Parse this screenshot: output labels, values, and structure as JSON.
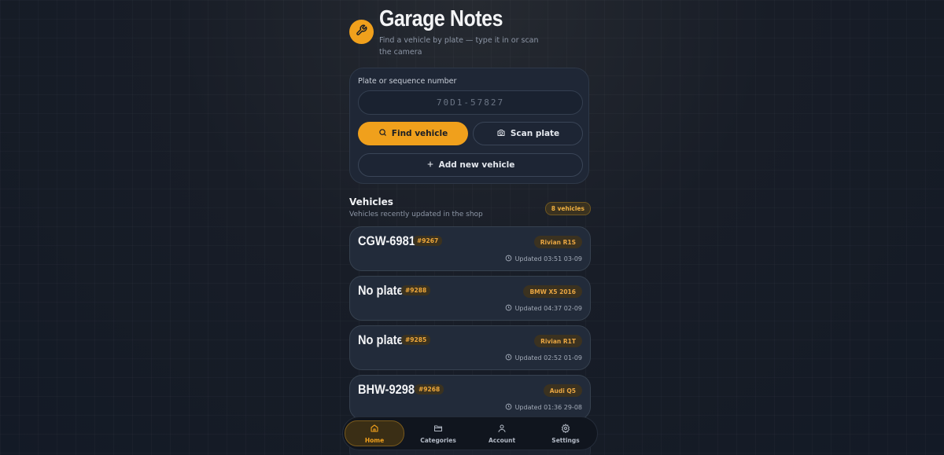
{
  "app": {
    "title": "Garage Notes",
    "subtitle": "Find a vehicle by plate — type it in or scan the camera",
    "accent_color": "#f0a01c",
    "logo_icon": "wrench-icon"
  },
  "search": {
    "label": "Plate or sequence number",
    "placeholder": "70D1-57827",
    "value": "",
    "find_label": "Find vehicle",
    "scan_label": "Scan plate",
    "add_label": "Add new vehicle"
  },
  "vehicles_section": {
    "title": "Vehicles",
    "subtitle": "Vehicles recently updated in the shop",
    "count_label": "8 vehicles"
  },
  "vehicles": [
    {
      "plate": "CGW-6981",
      "seq": "#9267",
      "model": "Rivian R1S",
      "updated": "Updated 03:51 03-09"
    },
    {
      "plate": "No plate",
      "seq": "#9288",
      "model": "BMW X5 2016",
      "updated": "Updated 04:37 02-09"
    },
    {
      "plate": "No plate",
      "seq": "#9285",
      "model": "Rivian R1T",
      "updated": "Updated 02:52 01-09"
    },
    {
      "plate": "BHW-9298",
      "seq": "#9268",
      "model": "Audi Q5",
      "updated": "Updated 01:36 29-08"
    }
  ],
  "nav": {
    "items": [
      {
        "label": "Home",
        "icon": "home-icon",
        "active": true
      },
      {
        "label": "Categories",
        "icon": "folder-icon",
        "active": false
      },
      {
        "label": "Account",
        "icon": "user-icon",
        "active": false
      },
      {
        "label": "Settings",
        "icon": "gear-icon",
        "active": false
      }
    ]
  }
}
